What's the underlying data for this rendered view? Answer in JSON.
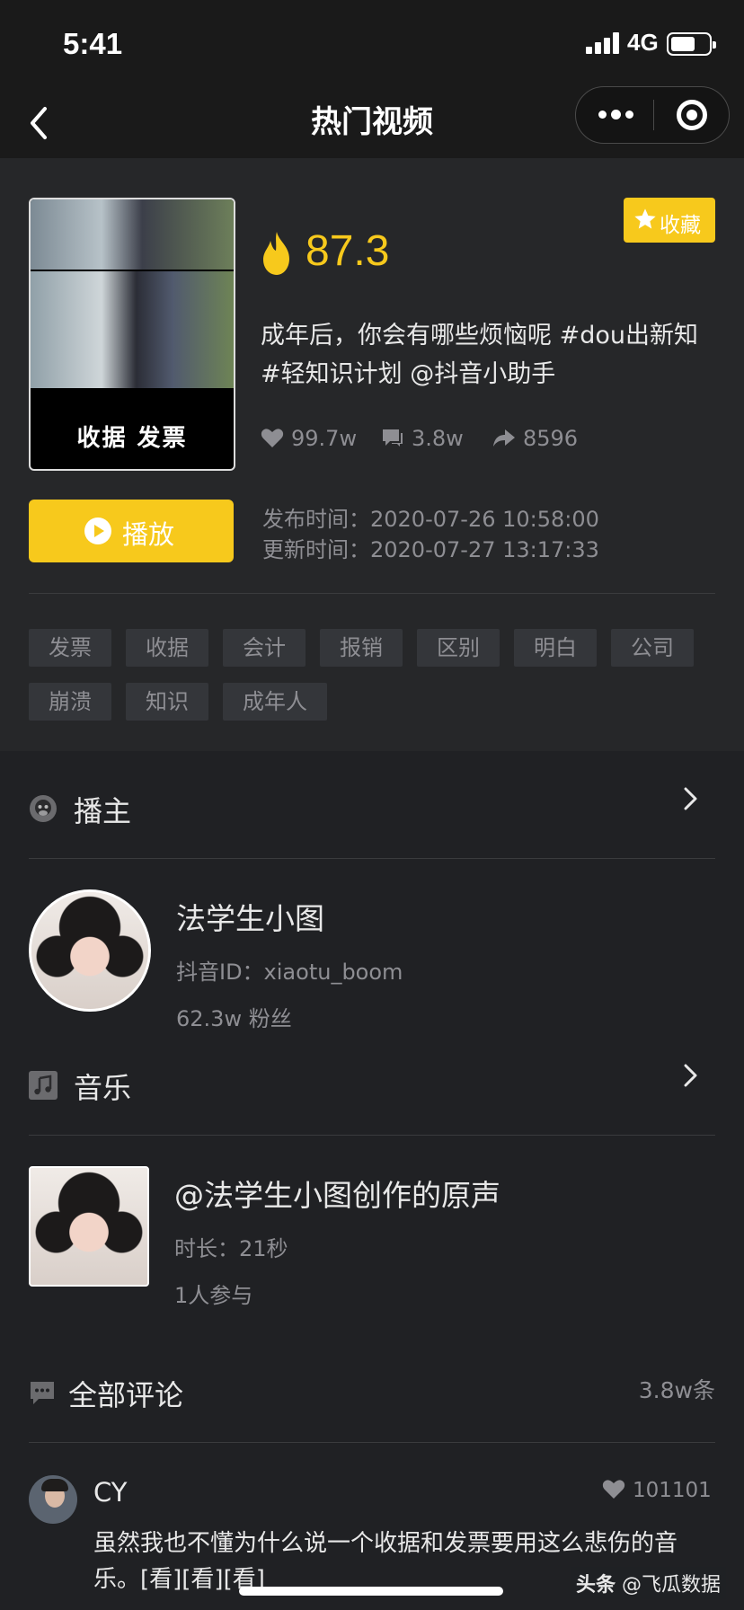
{
  "status_bar": {
    "time": "5:41",
    "network": "4G"
  },
  "nav": {
    "title": "热门视频"
  },
  "video": {
    "thumbnail_caption": "收据 发票",
    "favorite_label": "收藏",
    "score": "87.3",
    "description": "成年后，你会有哪些烦恼呢 #dou出新知 #轻知识计划 @抖音小助手",
    "likes": "99.7w",
    "comments": "3.8w",
    "shares": "8596",
    "play_label": "播放",
    "publish_time_label": "发布时间：",
    "publish_time": "2020-07-26 10:58:00",
    "update_time_label": "更新时间：",
    "update_time": "2020-07-27 13:17:33",
    "tags": [
      "发票",
      "收据",
      "会计",
      "报销",
      "区别",
      "明白",
      "公司",
      "崩溃",
      "知识",
      "成年人"
    ]
  },
  "host_section": {
    "title": "播主",
    "name": "法学生小图",
    "douyin_id": "抖音ID：xiaotu_boom",
    "followers": "62.3w 粉丝"
  },
  "music_section": {
    "title": "音乐",
    "track_name": "@法学生小图创作的原声",
    "duration": "时长：21秒",
    "participants": "1人参与"
  },
  "comments_section": {
    "title": "全部评论",
    "count": "3.8w条",
    "items": [
      {
        "user": "CY",
        "likes": "101101",
        "text": "虽然我也不懂为什么说一个收据和发票要用这么悲伤的音乐。[看][看][看]"
      }
    ]
  },
  "watermark": {
    "source": "头条",
    "account": "@飞瓜数据"
  },
  "colors": {
    "accent": "#f7c91c",
    "background": "#202124",
    "card": "#262729"
  }
}
